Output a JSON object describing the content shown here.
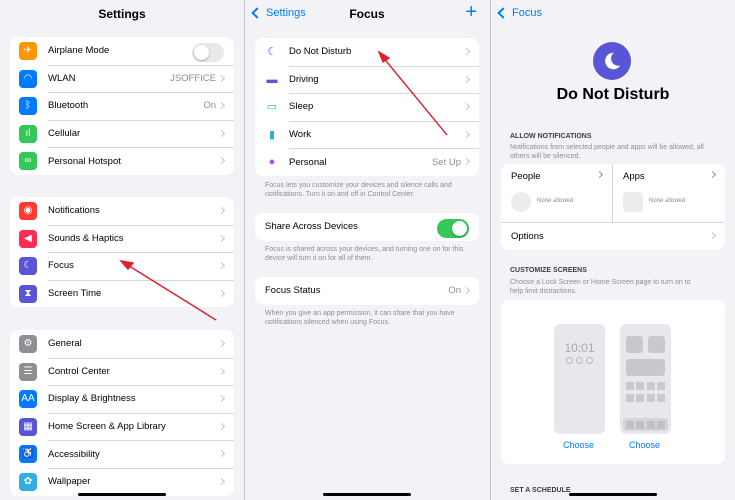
{
  "settings": {
    "title": "Settings",
    "group1": [
      {
        "label": "Airplane Mode",
        "icon": "airplane-icon",
        "color": "#ff9500",
        "toggle": false
      },
      {
        "label": "WLAN",
        "icon": "wifi-icon",
        "color": "#007aff",
        "value": "JSOFFICE"
      },
      {
        "label": "Bluetooth",
        "icon": "bluetooth-icon",
        "color": "#007aff",
        "value": "On"
      },
      {
        "label": "Cellular",
        "icon": "cellular-icon",
        "color": "#34c759"
      },
      {
        "label": "Personal Hotspot",
        "icon": "hotspot-icon",
        "color": "#34c759"
      }
    ],
    "group2": [
      {
        "label": "Notifications",
        "icon": "notifications-icon",
        "color": "#ff3b30"
      },
      {
        "label": "Sounds & Haptics",
        "icon": "sounds-icon",
        "color": "#ff2d55"
      },
      {
        "label": "Focus",
        "icon": "moon-icon",
        "color": "#5856d6"
      },
      {
        "label": "Screen Time",
        "icon": "hourglass-icon",
        "color": "#5856d6"
      }
    ],
    "group3": [
      {
        "label": "General",
        "icon": "gear-icon",
        "color": "#8e8e93"
      },
      {
        "label": "Control Center",
        "icon": "control-center-icon",
        "color": "#8e8e93"
      },
      {
        "label": "Display & Brightness",
        "icon": "brightness-icon",
        "color": "#007aff"
      },
      {
        "label": "Home Screen & App Library",
        "icon": "home-screen-icon",
        "color": "#5856d6"
      },
      {
        "label": "Accessibility",
        "icon": "accessibility-icon",
        "color": "#007aff"
      },
      {
        "label": "Wallpaper",
        "icon": "wallpaper-icon",
        "color": "#32ade6"
      }
    ]
  },
  "focus": {
    "back": "Settings",
    "title": "Focus",
    "plus": "+",
    "modes": [
      {
        "label": "Do Not Disturb",
        "icon": "moon-icon",
        "color": "#5856d6"
      },
      {
        "label": "Driving",
        "icon": "car-icon",
        "color": "#5856d6"
      },
      {
        "label": "Sleep",
        "icon": "bed-icon",
        "color": "#30b0c7"
      },
      {
        "label": "Work",
        "icon": "badge-icon",
        "color": "#30b0c7"
      },
      {
        "label": "Personal",
        "icon": "person-icon",
        "color": "#af52de",
        "value": "Set Up"
      }
    ],
    "modes_note": "Focus lets you customize your devices and silence calls and notifications. Turn it on and off in Control Center.",
    "share_label": "Share Across Devices",
    "share_on": true,
    "share_note": "Focus is shared across your devices, and turning one on for this device will turn it on for all of them.",
    "status_label": "Focus Status",
    "status_value": "On",
    "status_note": "When you give an app permission, it can share that you have notifications silenced when using Focus."
  },
  "dnd": {
    "back": "Focus",
    "title": "Do Not Disturb",
    "allow_header": "ALLOW NOTIFICATIONS",
    "allow_note": "Notifications from selected people and apps will be allowed, all others will be silenced.",
    "people_label": "People",
    "people_value": "None allowed",
    "apps_label": "Apps",
    "apps_value": "None allowed",
    "options_label": "Options",
    "customize_header": "CUSTOMIZE SCREENS",
    "customize_note": "Choose a Lock Screen or Home Screen page to turn on to help limit distractions.",
    "lock_time": "10:01",
    "choose_lock": "Choose",
    "choose_home": "Choose",
    "schedule_header": "SET A SCHEDULE"
  },
  "colors": {
    "accent": "#007aff",
    "arrow": "#e0202f",
    "toggle_on": "#34c759"
  }
}
